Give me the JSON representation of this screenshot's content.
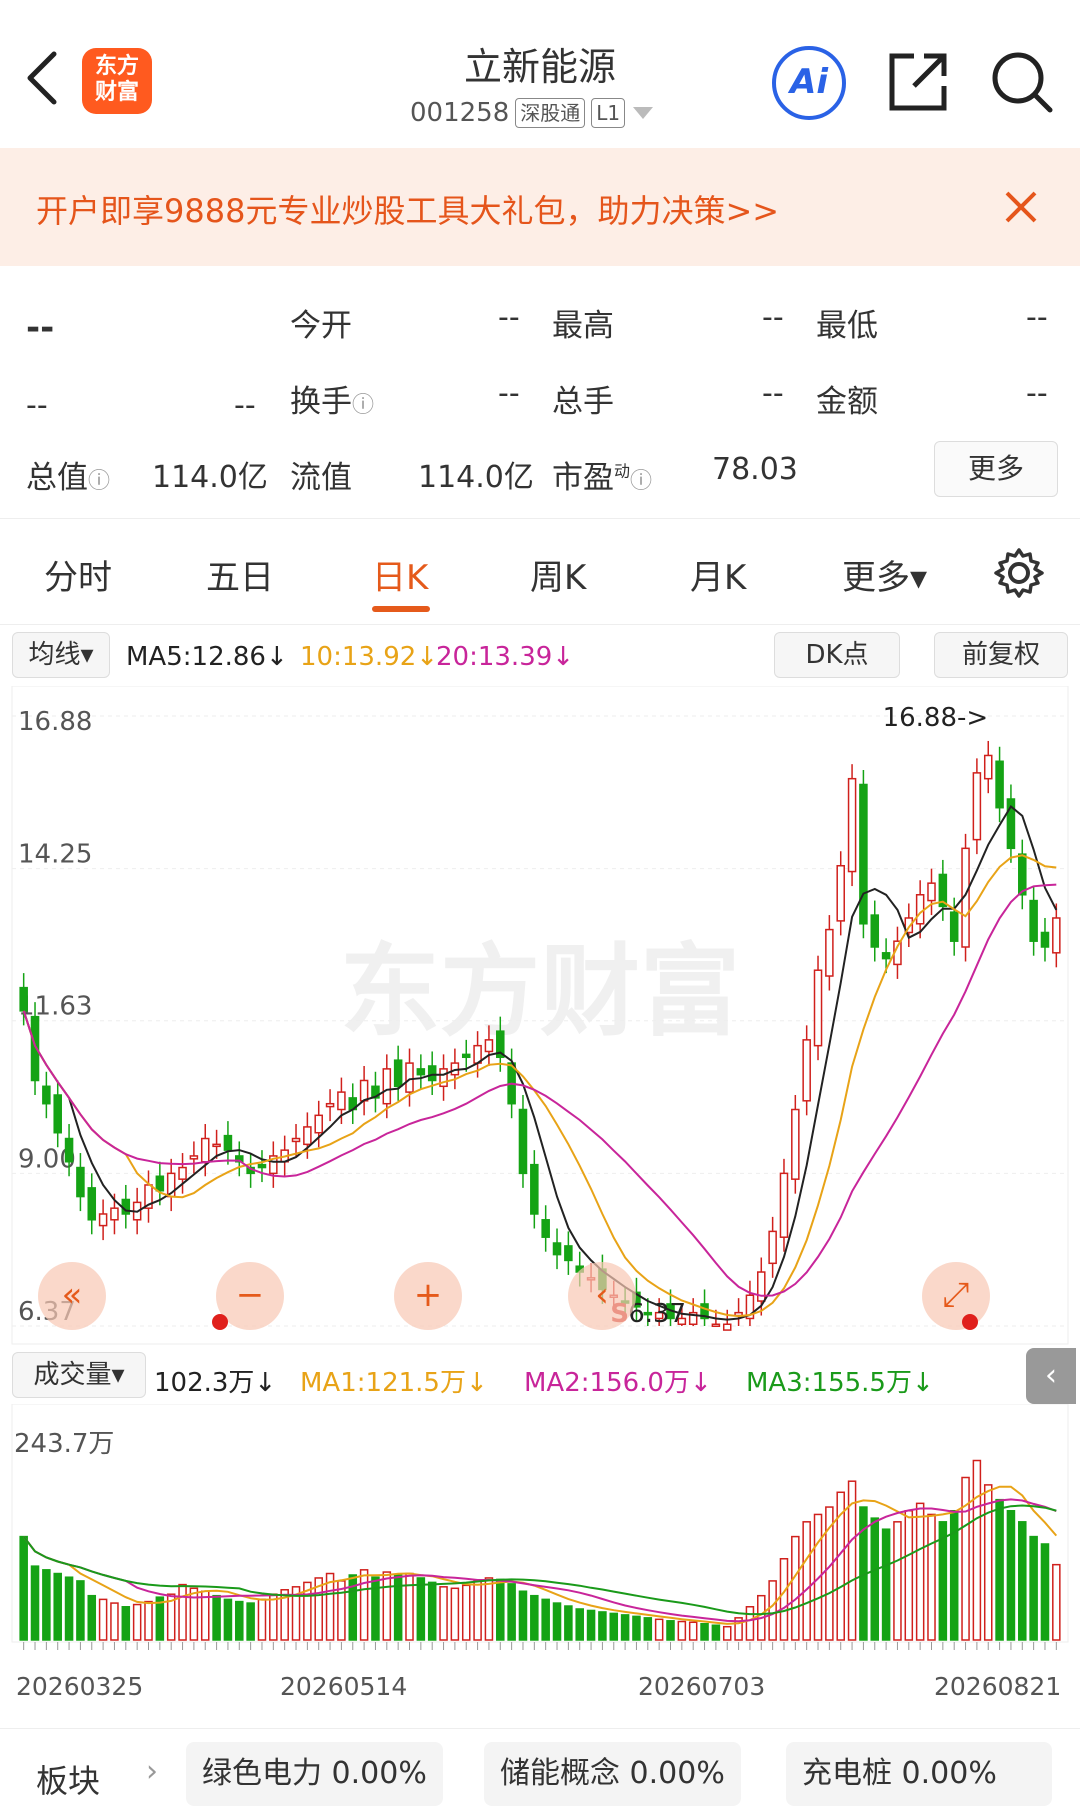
{
  "header": {
    "stock_name": "立新能源",
    "code": "001258",
    "tag1": "深股通",
    "tag2": "L1",
    "logo_line1": "东方",
    "logo_line2": "财富",
    "ai_label": "Ai"
  },
  "banner": {
    "text": "开户即享9888元专业炒股工具大礼包，助力决策>>"
  },
  "quote": {
    "price": "--",
    "change": "--",
    "change_pct": "--",
    "rows": [
      [
        {
          "label": "今开",
          "value": "--"
        },
        {
          "label": "最高",
          "value": "--"
        },
        {
          "label": "最低",
          "value": "--"
        }
      ],
      [
        {
          "label": "换手",
          "value": "--"
        },
        {
          "label": "总手",
          "value": "--"
        },
        {
          "label": "金额",
          "value": "--"
        }
      ]
    ],
    "total_value_label": "总值",
    "total_value": "114.0亿",
    "float_value_label": "流值",
    "float_value": "114.0亿",
    "pe_label": "市盈",
    "pe_sup": "动",
    "pe_value": "78.03",
    "more": "更多"
  },
  "tabs": [
    "分时",
    "五日",
    "日K",
    "周K",
    "月K",
    "更多▾"
  ],
  "active_tab": "日K",
  "ma": {
    "selector": "均线",
    "ma5": "MA5:12.86↓",
    "ma10": "10:13.92↓",
    "ma20": "20:13.39↓",
    "dk": "DK点",
    "adjust": "前复权",
    "colors": {
      "ma5": "#222222",
      "ma10": "#e8a317",
      "ma20": "#c8259a"
    }
  },
  "volume_bar": {
    "selector": "成交量",
    "vol": "102.3万↓",
    "ma1": "MA1:121.5万↓",
    "ma2": "MA2:156.0万↓",
    "ma3": "MA3:155.5万↓",
    "colors": {
      "ma1": "#e8a317",
      "ma2": "#c8259a",
      "ma3": "#1a9a1a"
    }
  },
  "chart_data": {
    "type": "candlestick",
    "y_ticks": [
      "16.88",
      "14.25",
      "11.63",
      "9.00",
      "6.37"
    ],
    "ylim": [
      6.37,
      16.88
    ],
    "high_annotation": "16.88->",
    "low_annotation": "6.37",
    "low_marker": "S",
    "volume_max_label": "243.7万",
    "dates": [
      "20260325",
      "20260514",
      "20260703",
      "20260821"
    ],
    "watermark": "东方财富",
    "up_color": "#d0201c",
    "down_color": "#15a315",
    "closes": [
      11.8,
      10.6,
      10.2,
      9.7,
      9.2,
      8.6,
      8.2,
      8.3,
      8.4,
      8.3,
      8.5,
      8.8,
      8.7,
      9.0,
      9.1,
      9.3,
      9.6,
      9.5,
      9.4,
      9.2,
      9.0,
      9.1,
      9.3,
      9.4,
      9.6,
      9.8,
      10.0,
      10.2,
      10.4,
      10.1,
      10.6,
      10.3,
      10.8,
      10.5,
      10.9,
      10.7,
      10.6,
      10.8,
      10.9,
      11.0,
      11.2,
      11.3,
      11.0,
      10.2,
      9.0,
      8.3,
      7.9,
      7.6,
      7.5,
      7.3,
      7.2,
      7.0,
      6.9,
      6.8,
      6.7,
      6.6,
      6.6,
      6.5,
      6.5,
      6.6,
      6.5,
      6.4,
      6.4,
      6.6,
      6.9,
      7.3,
      8.0,
      9.0,
      10.1,
      11.3,
      12.5,
      13.2,
      14.3,
      15.8,
      13.3,
      12.9,
      12.7,
      13.0,
      13.4,
      13.8,
      14.0,
      13.6,
      13.0,
      14.6,
      15.9,
      16.2,
      15.3,
      14.6,
      13.8,
      13.0,
      12.9,
      13.4
    ],
    "volumes": [
      140,
      100,
      95,
      90,
      85,
      80,
      60,
      55,
      50,
      45,
      48,
      52,
      58,
      62,
      75,
      70,
      66,
      60,
      55,
      52,
      50,
      55,
      62,
      68,
      72,
      78,
      84,
      90,
      80,
      88,
      95,
      85,
      92,
      88,
      90,
      84,
      78,
      72,
      70,
      74,
      80,
      84,
      82,
      76,
      66,
      60,
      55,
      50,
      46,
      42,
      40,
      38,
      36,
      34,
      32,
      30,
      28,
      26,
      25,
      24,
      22,
      20,
      18,
      30,
      45,
      60,
      80,
      110,
      140,
      160,
      170,
      180,
      200,
      215,
      180,
      165,
      150,
      160,
      175,
      185,
      170,
      160,
      175,
      220,
      243,
      210,
      190,
      175,
      160,
      140,
      130,
      102
    ]
  },
  "sectors": {
    "label": "板块",
    "items": [
      {
        "name": "绿色电力",
        "pct": "0.00%"
      },
      {
        "name": "储能概念",
        "pct": "0.00%"
      },
      {
        "name": "充电桩",
        "pct": "0.00%"
      }
    ]
  }
}
